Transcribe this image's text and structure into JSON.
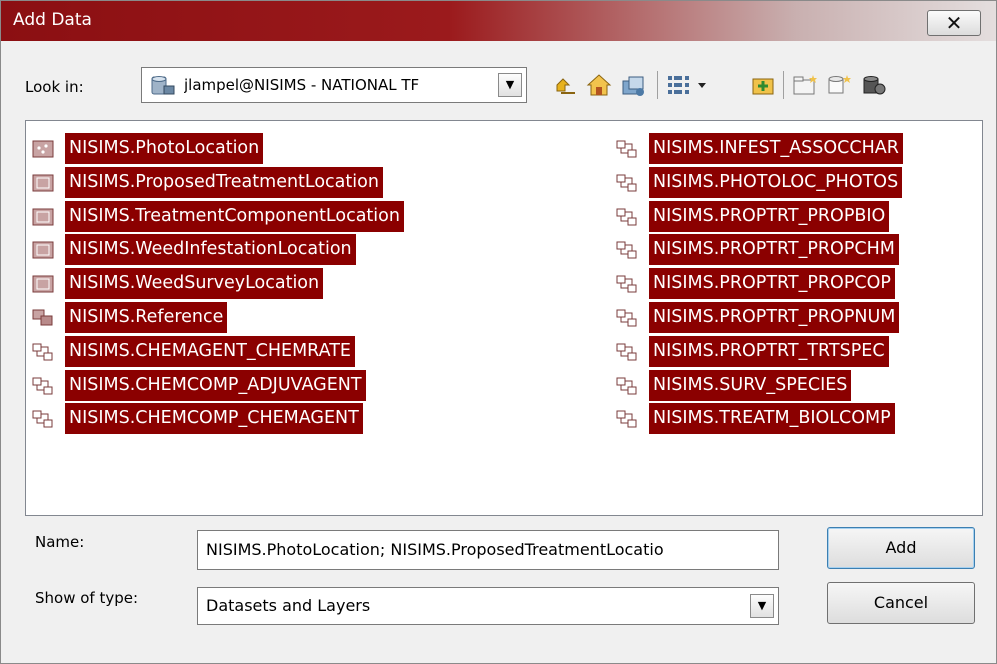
{
  "window": {
    "title": "Add Data",
    "close_label": "✕"
  },
  "lookin": {
    "label": "Look in:",
    "value": "jlampel@NISIMS - NATIONAL TF",
    "icon": "database-connection-icon"
  },
  "toolbar": {
    "icons": [
      "up-one-level-icon",
      "home-icon",
      "connect-to-folder-icon",
      "view-menu-icon",
      "new-item-icon",
      "new-folder-icon",
      "new-feature-class-icon",
      "geodatabase-icon"
    ]
  },
  "files": {
    "left": [
      {
        "label": "NISIMS.PhotoLocation",
        "icon": "point-feature-class-icon"
      },
      {
        "label": "NISIMS.ProposedTreatmentLocation",
        "icon": "polygon-feature-class-icon"
      },
      {
        "label": "NISIMS.TreatmentComponentLocation",
        "icon": "polygon-feature-class-icon"
      },
      {
        "label": "NISIMS.WeedInfestationLocation",
        "icon": "polygon-feature-class-icon"
      },
      {
        "label": "NISIMS.WeedSurveyLocation",
        "icon": "polygon-feature-class-icon"
      },
      {
        "label": "NISIMS.Reference",
        "icon": "relationship-class-icon"
      },
      {
        "label": "NISIMS.CHEMAGENT_CHEMRATE",
        "icon": "relationship-class-icon"
      },
      {
        "label": "NISIMS.CHEMCOMP_ADJUVAGENT",
        "icon": "relationship-class-icon"
      },
      {
        "label": "NISIMS.CHEMCOMP_CHEMAGENT",
        "icon": "relationship-class-icon"
      }
    ],
    "right": [
      {
        "label": "NISIMS.INFEST_ASSOCCHAR",
        "icon": "relationship-class-icon"
      },
      {
        "label": "NISIMS.PHOTOLOC_PHOTOS",
        "icon": "relationship-class-icon"
      },
      {
        "label": "NISIMS.PROPTRT_PROPBIO",
        "icon": "relationship-class-icon"
      },
      {
        "label": "NISIMS.PROPTRT_PROPCHM",
        "icon": "relationship-class-icon"
      },
      {
        "label": "NISIMS.PROPTRT_PROPCOP",
        "icon": "relationship-class-icon"
      },
      {
        "label": "NISIMS.PROPTRT_PROPNUM",
        "icon": "relationship-class-icon"
      },
      {
        "label": "NISIMS.PROPTRT_TRTSPEC",
        "icon": "relationship-class-icon"
      },
      {
        "label": "NISIMS.SURV_SPECIES",
        "icon": "relationship-class-icon"
      },
      {
        "label": "NISIMS.TREATM_BIOLCOMP",
        "icon": "relationship-class-icon"
      }
    ]
  },
  "form": {
    "name_label": "Name:",
    "name_value": "NISIMS.PhotoLocation; NISIMS.ProposedTreatmentLocatio",
    "type_label": "Show of type:",
    "type_value": "Datasets and Layers"
  },
  "buttons": {
    "add": "Add",
    "cancel": "Cancel"
  },
  "colors": {
    "selection": "#8b0000",
    "titlebar": "#8b0f12"
  }
}
